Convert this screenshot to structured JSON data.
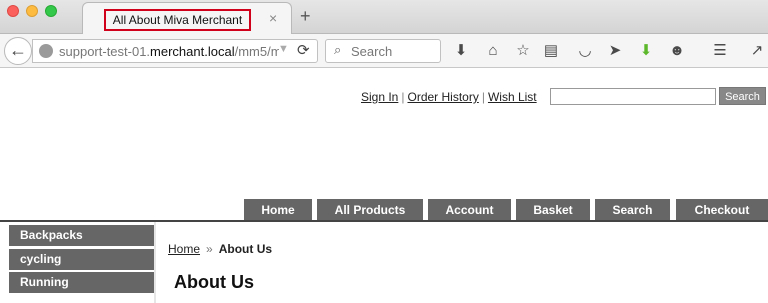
{
  "browser": {
    "tab_title": "All About Miva Merchant",
    "tab_close": "×",
    "new_tab": "+",
    "url_host": "support-test-01.",
    "url_domain": "merchant.local",
    "url_path": "/mm5/m",
    "search_placeholder": "Search",
    "icons": [
      "download-icon",
      "home-icon",
      "bookmark-star-icon",
      "reading-list-icon",
      "pocket-icon",
      "send-icon",
      "green-download-icon",
      "smiley-icon",
      "menu-icon",
      "tool-icon"
    ]
  },
  "header": {
    "links": [
      {
        "label": "Sign In"
      },
      {
        "label": "Order History"
      },
      {
        "label": "Wish List"
      }
    ],
    "search_button": "Search"
  },
  "nav": {
    "items": [
      "Home",
      "All Products",
      "Account",
      "Basket",
      "Search",
      "Checkout"
    ]
  },
  "sidebar": {
    "items": [
      "Backpacks",
      "cycling",
      "Running"
    ]
  },
  "breadcrumb": {
    "home": "Home",
    "separator": "»",
    "current": "About Us"
  },
  "page": {
    "title": "About Us"
  }
}
